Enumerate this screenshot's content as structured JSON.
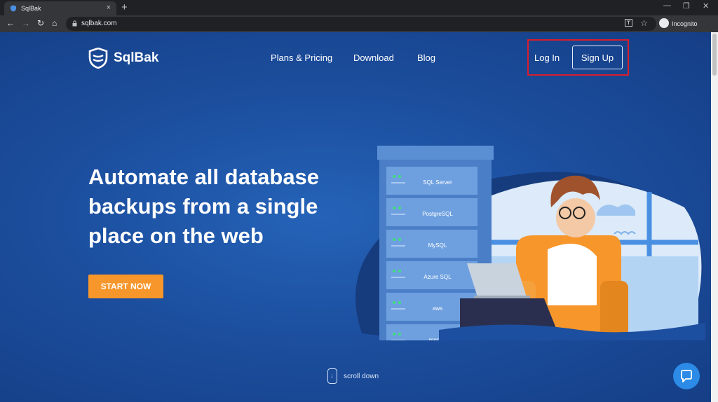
{
  "browser": {
    "tab_title": "SqlBak",
    "tab_close": "×",
    "new_tab": "+",
    "url": "sqlbak.com",
    "profile_label": "Incognito",
    "icons": [
      "back-icon",
      "forward-icon",
      "reload-icon",
      "home-icon",
      "lock-icon",
      "translate-icon",
      "star-icon",
      "incognito-icon",
      "menu-icon"
    ],
    "nav_glyphs": {
      "back": "←",
      "forward": "→",
      "reload": "↻",
      "home": "⌂",
      "star": "☆",
      "menu": "⋮"
    },
    "window_glyphs": {
      "minimize": "—",
      "restore": "❐",
      "close": "✕"
    }
  },
  "site": {
    "brand": "SqlBak",
    "nav": {
      "pricing": "Plans & Pricing",
      "download": "Download",
      "blog": "Blog",
      "login": "Log In",
      "signup": "Sign Up"
    },
    "hero": {
      "headline": "Automate all database backups from a single place on the web",
      "cta": "START NOW"
    },
    "illustration": {
      "db_labels": [
        "SQL Server",
        "PostgreSQL",
        "MySQL",
        "Azure SQL",
        "aws",
        "mongo"
      ]
    },
    "scroll_label": "scroll down",
    "scroll_glyph": "↓"
  },
  "colors": {
    "background": "#1d4fa0",
    "cta": "#f7962b",
    "highlight": "#d81e2c",
    "chat": "#2b8be6"
  }
}
